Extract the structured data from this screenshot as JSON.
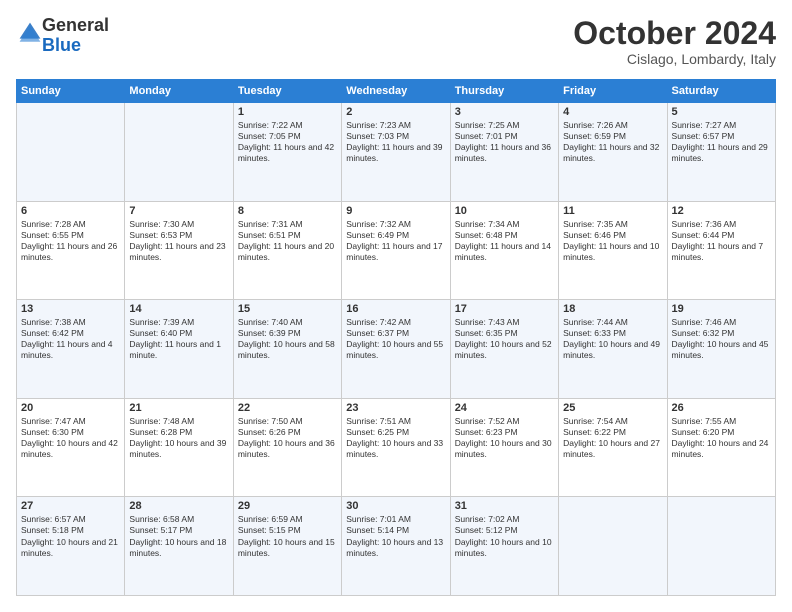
{
  "header": {
    "logo_general": "General",
    "logo_blue": "Blue",
    "month_title": "October 2024",
    "subtitle": "Cislago, Lombardy, Italy"
  },
  "weekdays": [
    "Sunday",
    "Monday",
    "Tuesday",
    "Wednesday",
    "Thursday",
    "Friday",
    "Saturday"
  ],
  "weeks": [
    [
      {
        "day": "",
        "info": ""
      },
      {
        "day": "",
        "info": ""
      },
      {
        "day": "1",
        "info": "Sunrise: 7:22 AM\nSunset: 7:05 PM\nDaylight: 11 hours and 42 minutes."
      },
      {
        "day": "2",
        "info": "Sunrise: 7:23 AM\nSunset: 7:03 PM\nDaylight: 11 hours and 39 minutes."
      },
      {
        "day": "3",
        "info": "Sunrise: 7:25 AM\nSunset: 7:01 PM\nDaylight: 11 hours and 36 minutes."
      },
      {
        "day": "4",
        "info": "Sunrise: 7:26 AM\nSunset: 6:59 PM\nDaylight: 11 hours and 32 minutes."
      },
      {
        "day": "5",
        "info": "Sunrise: 7:27 AM\nSunset: 6:57 PM\nDaylight: 11 hours and 29 minutes."
      }
    ],
    [
      {
        "day": "6",
        "info": "Sunrise: 7:28 AM\nSunset: 6:55 PM\nDaylight: 11 hours and 26 minutes."
      },
      {
        "day": "7",
        "info": "Sunrise: 7:30 AM\nSunset: 6:53 PM\nDaylight: 11 hours and 23 minutes."
      },
      {
        "day": "8",
        "info": "Sunrise: 7:31 AM\nSunset: 6:51 PM\nDaylight: 11 hours and 20 minutes."
      },
      {
        "day": "9",
        "info": "Sunrise: 7:32 AM\nSunset: 6:49 PM\nDaylight: 11 hours and 17 minutes."
      },
      {
        "day": "10",
        "info": "Sunrise: 7:34 AM\nSunset: 6:48 PM\nDaylight: 11 hours and 14 minutes."
      },
      {
        "day": "11",
        "info": "Sunrise: 7:35 AM\nSunset: 6:46 PM\nDaylight: 11 hours and 10 minutes."
      },
      {
        "day": "12",
        "info": "Sunrise: 7:36 AM\nSunset: 6:44 PM\nDaylight: 11 hours and 7 minutes."
      }
    ],
    [
      {
        "day": "13",
        "info": "Sunrise: 7:38 AM\nSunset: 6:42 PM\nDaylight: 11 hours and 4 minutes."
      },
      {
        "day": "14",
        "info": "Sunrise: 7:39 AM\nSunset: 6:40 PM\nDaylight: 11 hours and 1 minute."
      },
      {
        "day": "15",
        "info": "Sunrise: 7:40 AM\nSunset: 6:39 PM\nDaylight: 10 hours and 58 minutes."
      },
      {
        "day": "16",
        "info": "Sunrise: 7:42 AM\nSunset: 6:37 PM\nDaylight: 10 hours and 55 minutes."
      },
      {
        "day": "17",
        "info": "Sunrise: 7:43 AM\nSunset: 6:35 PM\nDaylight: 10 hours and 52 minutes."
      },
      {
        "day": "18",
        "info": "Sunrise: 7:44 AM\nSunset: 6:33 PM\nDaylight: 10 hours and 49 minutes."
      },
      {
        "day": "19",
        "info": "Sunrise: 7:46 AM\nSunset: 6:32 PM\nDaylight: 10 hours and 45 minutes."
      }
    ],
    [
      {
        "day": "20",
        "info": "Sunrise: 7:47 AM\nSunset: 6:30 PM\nDaylight: 10 hours and 42 minutes."
      },
      {
        "day": "21",
        "info": "Sunrise: 7:48 AM\nSunset: 6:28 PM\nDaylight: 10 hours and 39 minutes."
      },
      {
        "day": "22",
        "info": "Sunrise: 7:50 AM\nSunset: 6:26 PM\nDaylight: 10 hours and 36 minutes."
      },
      {
        "day": "23",
        "info": "Sunrise: 7:51 AM\nSunset: 6:25 PM\nDaylight: 10 hours and 33 minutes."
      },
      {
        "day": "24",
        "info": "Sunrise: 7:52 AM\nSunset: 6:23 PM\nDaylight: 10 hours and 30 minutes."
      },
      {
        "day": "25",
        "info": "Sunrise: 7:54 AM\nSunset: 6:22 PM\nDaylight: 10 hours and 27 minutes."
      },
      {
        "day": "26",
        "info": "Sunrise: 7:55 AM\nSunset: 6:20 PM\nDaylight: 10 hours and 24 minutes."
      }
    ],
    [
      {
        "day": "27",
        "info": "Sunrise: 6:57 AM\nSunset: 5:18 PM\nDaylight: 10 hours and 21 minutes."
      },
      {
        "day": "28",
        "info": "Sunrise: 6:58 AM\nSunset: 5:17 PM\nDaylight: 10 hours and 18 minutes."
      },
      {
        "day": "29",
        "info": "Sunrise: 6:59 AM\nSunset: 5:15 PM\nDaylight: 10 hours and 15 minutes."
      },
      {
        "day": "30",
        "info": "Sunrise: 7:01 AM\nSunset: 5:14 PM\nDaylight: 10 hours and 13 minutes."
      },
      {
        "day": "31",
        "info": "Sunrise: 7:02 AM\nSunset: 5:12 PM\nDaylight: 10 hours and 10 minutes."
      },
      {
        "day": "",
        "info": ""
      },
      {
        "day": "",
        "info": ""
      }
    ]
  ]
}
